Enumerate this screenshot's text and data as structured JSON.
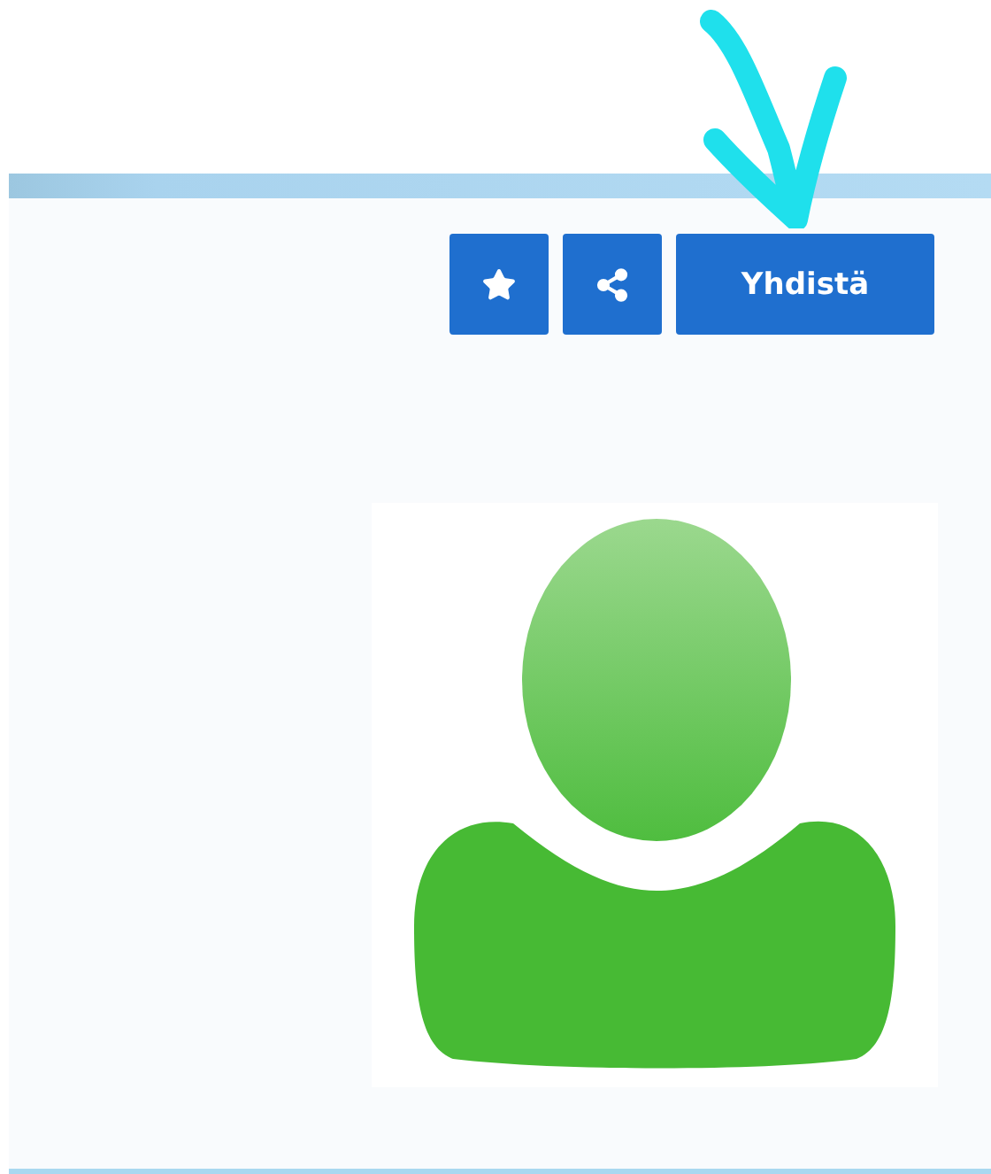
{
  "toolbar": {
    "connect_button": {
      "label": "Yhdistä"
    }
  }
}
